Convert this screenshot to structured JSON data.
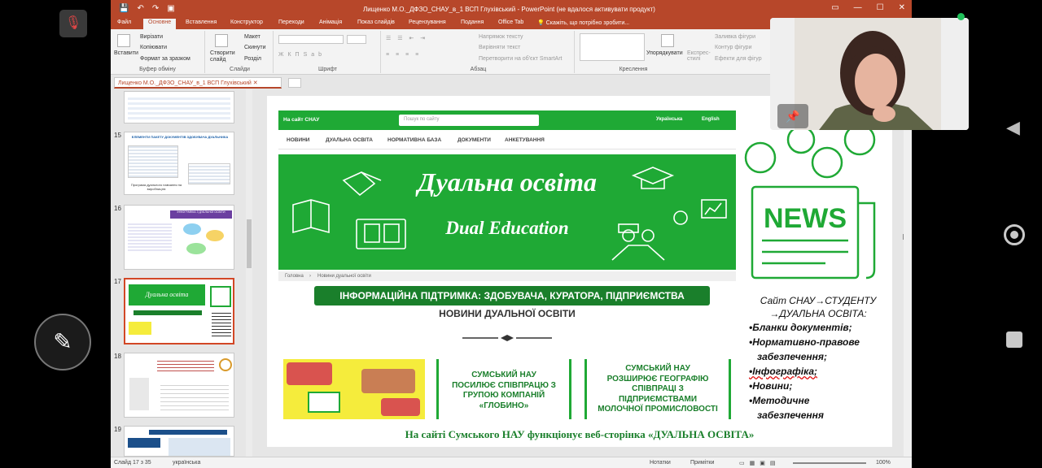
{
  "app": {
    "title": "Лищенко М.О._ДФЗО_СНАУ_в_1  ВСП Глухівський - PowerPoint (не вдалося активувати продукт)",
    "tabs": [
      "Файл",
      "Основне",
      "Вставлення",
      "Конструктор",
      "Переходи",
      "Анімація",
      "Показ слайдів",
      "Рецензування",
      "Подання",
      "Office Tab"
    ],
    "tell_me": "Скажіть, що потрібно зробити..."
  },
  "ribbon": {
    "paste": "Вставити",
    "cut": "Вирізати",
    "copy": "Копіювати",
    "format_painter": "Формат за зразком",
    "group_clipboard": "Буфер обміну",
    "new_slide": "Створити слайд",
    "layout": "Макет",
    "reset": "Скинути",
    "section": "Розділ",
    "group_slides": "Слайди",
    "group_font": "Шрифт",
    "group_paragraph": "Абзац",
    "text_direction": "Напрямок тексту",
    "align_text": "Вирівняти текст",
    "convert_smartart": "Перетворити на об'єкт SmartArt",
    "arrange": "Упорядкувати",
    "quick_styles": "Експрес-стилі",
    "shape_fill": "Заливка фігури",
    "shape_outline": "Контур фігури",
    "shape_effects": "Ефекти для фігур",
    "group_drawing": "Креслення"
  },
  "doc_tab": {
    "label": "Лищенко М.О._ДФЗО_СНАУ_в_1  ВСП Глухівський"
  },
  "thumbnails": [
    {
      "num": "15",
      "title": "ЕЛЕМЕНТИ ПАКЕТУ ДОКУМЕНТІВ ЗДОБУВАЧА ДУАЛЬНИКА",
      "caption": "Програма дуального навчання на виробництві"
    },
    {
      "num": "16",
      "title": "ІНФОГРАФІКА З ДУАЛЬНОЇ ОСВІТИ"
    },
    {
      "num": "17",
      "title": "Дуальна освіта",
      "selected": true
    },
    {
      "num": "18"
    },
    {
      "num": "19"
    }
  ],
  "slide": {
    "web_site_link": "На сайт СНАУ",
    "web_search": "Пошук по сайту",
    "lang_ua": "Українська",
    "lang_en": "English",
    "nav": [
      "НОВИНИ",
      "ДУАЛЬНА ОСВІТА",
      "НОРМАТИВНА БАЗА",
      "ДОКУМЕНТИ",
      "АНКЕТУВАННЯ"
    ],
    "banner_title": "Дуальна освіта",
    "banner_subtitle": "Dual Education",
    "breadcrumb_home": "Головна",
    "breadcrumb_sep": "›",
    "breadcrumb_current": "Новини дуальної освіти",
    "green_heading": "ІНФОРМАЦІЙНА ПІДТРИМКА: ЗДОБУВАЧА, КУРАТОРА, ПІДПРИЄМСТВА",
    "news_heading": "НОВИНИ ДУАЛЬНОЇ ОСВІТИ",
    "news_card_2": [
      "СУМСЬКИЙ НАУ",
      "ПОСИЛЮЄ СПІВПРАЦЮ З",
      "ГРУПОЮ КОМПАНІЙ",
      "«ГЛОБИНО»"
    ],
    "news_card_3": [
      "СУМСЬКИЙ НАУ",
      "РОЗШИРЮЄ ГЕОГРАФІЮ",
      "СПІВПРАЦІ З",
      "ПІДПРИЄМСТВАМИ",
      "МОЛОЧНОЇ ПРОМИСЛОВОСТІ"
    ],
    "news_graphic": "NEWS",
    "caption": "На сайті Сумського НАУ функціонує веб-сторінка «ДУАЛЬНА ОСВІТА»",
    "right_heading_1": "Сайт СНАУ→СТУДЕНТУ",
    "right_heading_2": "→ДУАЛЬНА ОСВІТА:",
    "right_items": [
      "•Бланки документів;",
      "•Нормативно-правове",
      "забезпечення;",
      "•Інфографіка;",
      "•Новини;",
      "•Методичне",
      "забезпечення"
    ]
  },
  "status": {
    "slide": "Слайд 17 з 35",
    "language": "українська",
    "notes": "Нотатки",
    "comments": "Примітки",
    "zoom": "100%"
  },
  "colors": {
    "ppt_accent": "#b7472a",
    "site_green": "#1fa935",
    "dark_green": "#1a7f2b"
  }
}
